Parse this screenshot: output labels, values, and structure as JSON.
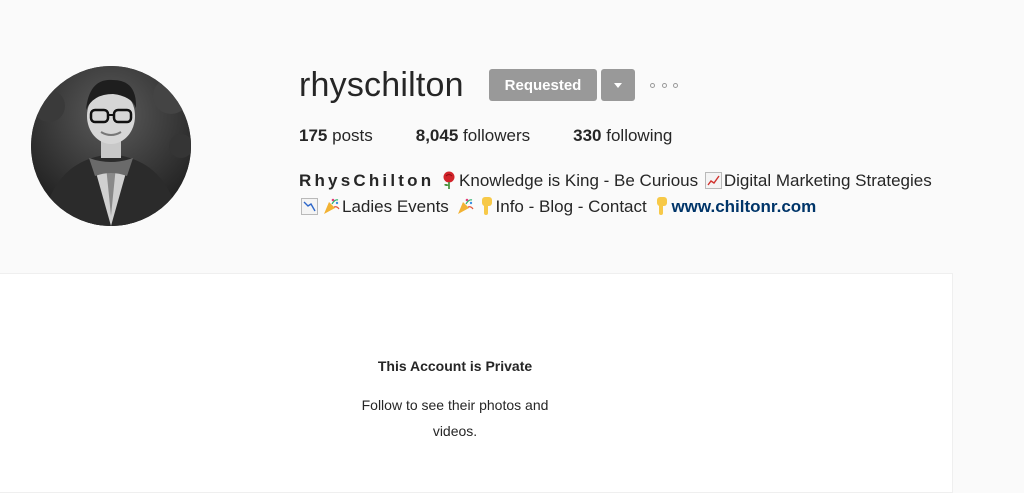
{
  "profile": {
    "username": "rhyschilton",
    "follow_button_label": "Requested",
    "stats": {
      "posts_count": "175",
      "posts_label": "posts",
      "followers_count": "8,045",
      "followers_label": "followers",
      "following_count": "330",
      "following_label": "following"
    },
    "bio": {
      "name": "RhysChilton",
      "text_1": "Knowledge is King - Be Curious",
      "text_2": "Digital Marketing Strategies",
      "text_3": "Ladies Events",
      "text_4": "Info - Blog - Contact",
      "website": "www.chiltonr.com"
    }
  },
  "private_notice": {
    "title": "This Account is Private",
    "subtitle": "Follow to see their photos and videos."
  },
  "icons": {
    "dropdown": "caret-down-icon",
    "more": "more-options-icon",
    "emojis": [
      "rose-icon",
      "chart-increasing-icon",
      "chart-decreasing-icon",
      "party-popper-icon",
      "backhand-index-pointing-down-icon"
    ]
  },
  "colors": {
    "button_gray": "#999999",
    "link": "#003569",
    "background": "#fafafa"
  }
}
